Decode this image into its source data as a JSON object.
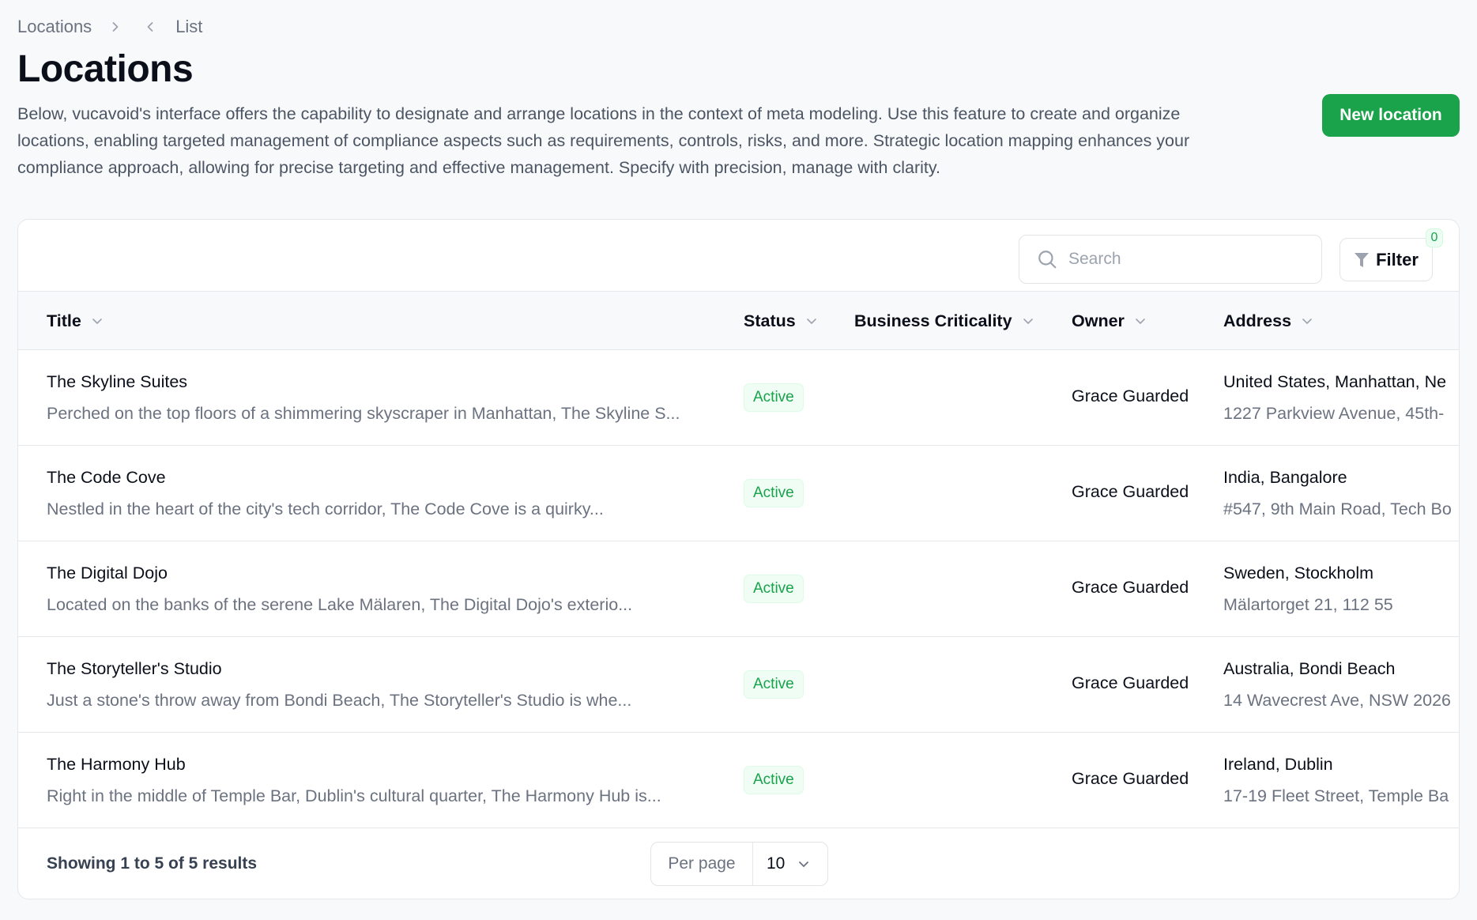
{
  "breadcrumb": {
    "items": [
      "Locations",
      "List"
    ],
    "separator_icon": "chevron-right-icon",
    "back_icon": "chevron-left-icon"
  },
  "page": {
    "title": "Locations",
    "description": "Below, vucavoid's interface offers the capability to designate and arrange locations in the context of meta modeling. Use this feature to create and organize locations, enabling targeted management of compliance aspects such as requirements, controls, risks, and more. Strategic location mapping enhances your compliance approach, allowing for precise targeting and effective management. Specify with precision, manage with clarity.",
    "new_button_label": "New location",
    "brand_color": "#1aa34a"
  },
  "toolbar": {
    "search_placeholder": "Search",
    "search_value": "",
    "filter_label": "Filter",
    "filter_count": "0"
  },
  "table": {
    "columns": [
      {
        "key": "title",
        "label": "Title"
      },
      {
        "key": "status",
        "label": "Status"
      },
      {
        "key": "business_criticality",
        "label": "Business Criticality"
      },
      {
        "key": "owner",
        "label": "Owner"
      },
      {
        "key": "address",
        "label": "Address"
      }
    ],
    "rows": [
      {
        "title": "The Skyline Suites",
        "description": "Perched on the top floors of a shimmering skyscraper in Manhattan, The Skyline S...",
        "status": "Active",
        "business_criticality": "",
        "owner": "Grace Guarded",
        "address_region": "United States, Manhattan, Ne",
        "address_street": "1227 Parkview Avenue, 45th-"
      },
      {
        "title": "The Code Cove",
        "description": "Nestled in the heart of the city's tech corridor, The Code Cove is a quirky...",
        "status": "Active",
        "business_criticality": "",
        "owner": "Grace Guarded",
        "address_region": "India, Bangalore",
        "address_street": "#547, 9th Main Road, Tech Bo"
      },
      {
        "title": "The Digital Dojo",
        "description": "Located on the banks of the serene Lake Mälaren, The Digital Dojo's exterio...",
        "status": "Active",
        "business_criticality": "",
        "owner": "Grace Guarded",
        "address_region": "Sweden, Stockholm",
        "address_street": "Mälartorget 21, 112 55"
      },
      {
        "title": "The Storyteller's Studio",
        "description": "Just a stone's throw away from Bondi Beach, The Storyteller's Studio is whe...",
        "status": "Active",
        "business_criticality": "",
        "owner": "Grace Guarded",
        "address_region": "Australia, Bondi Beach",
        "address_street": "14 Wavecrest Ave, NSW 2026"
      },
      {
        "title": "The Harmony Hub",
        "description": "Right in the middle of Temple Bar, Dublin's cultural quarter, The Harmony Hub is...",
        "status": "Active",
        "business_criticality": "",
        "owner": "Grace Guarded",
        "address_region": "Ireland, Dublin",
        "address_street": "17-19 Fleet Street, Temple Ba"
      }
    ]
  },
  "pagination": {
    "results_text": "Showing 1 to 5 of 5 results",
    "per_page_label": "Per page",
    "per_page_value": "10"
  }
}
